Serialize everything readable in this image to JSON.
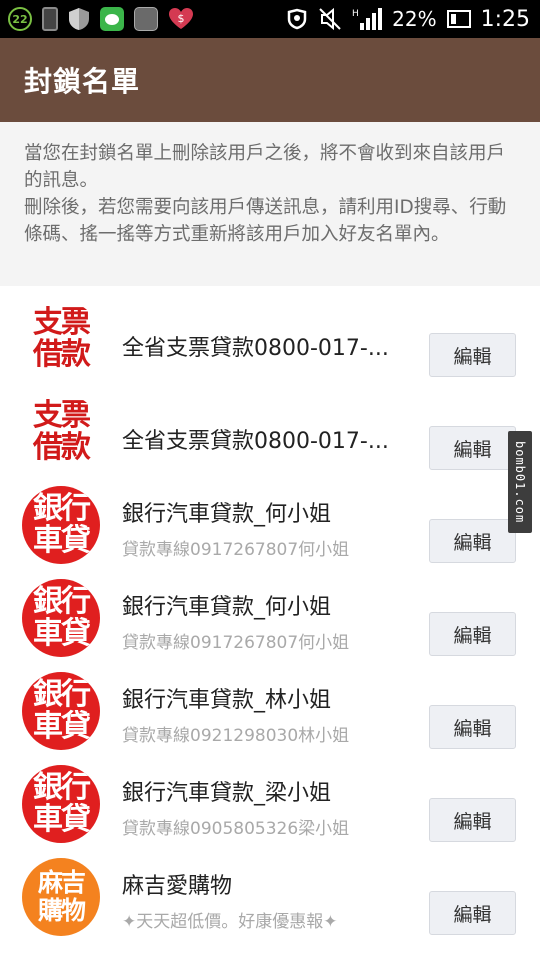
{
  "status_bar": {
    "notification_count": "22",
    "battery_percent": "22%",
    "time": "1:25"
  },
  "header": {
    "title": "封鎖名單"
  },
  "notice": {
    "line1": "當您在封鎖名單上刪除該用戶之後，將不會收到來自該用戶的訊息。",
    "line2": "刪除後，若您需要向該用戶傳送訊息，請利用ID搜尋、行動條碼、搖一搖等方式重新將該用戶加入好友名單內。"
  },
  "edit_label": "編輯",
  "blocked_users": [
    {
      "name": "全省支票貸款0800-017-...",
      "subtitle": "",
      "avatar_text": [
        "支票",
        "借款"
      ],
      "avatar_style": "stamp"
    },
    {
      "name": "全省支票貸款0800-017-...",
      "subtitle": "",
      "avatar_text": [
        "支票",
        "借款"
      ],
      "avatar_style": "stamp"
    },
    {
      "name": "銀行汽車貸款_何小姐",
      "subtitle": "貸款專線0917267807何小姐",
      "avatar_text": [
        "銀行",
        "車貸"
      ],
      "avatar_style": "red"
    },
    {
      "name": "銀行汽車貸款_何小姐",
      "subtitle": "貸款專線0917267807何小姐",
      "avatar_text": [
        "銀行",
        "車貸"
      ],
      "avatar_style": "red"
    },
    {
      "name": "銀行汽車貸款_林小姐",
      "subtitle": "貸款專線0921298030林小姐",
      "avatar_text": [
        "銀行",
        "車貸"
      ],
      "avatar_style": "red"
    },
    {
      "name": "銀行汽車貸款_梁小姐",
      "subtitle": "貸款專線0905805326梁小姐",
      "avatar_text": [
        "銀行",
        "車貸"
      ],
      "avatar_style": "red"
    },
    {
      "name": "麻吉愛購物",
      "subtitle": "✦天天超低價。好康優惠報✦",
      "avatar_text": [
        "麻吉",
        "購物"
      ],
      "avatar_style": "orange"
    }
  ],
  "watermark": "bomb01.com",
  "colors": {
    "header_bg": "#6b4c3d",
    "avatar_red": "#e01f1f",
    "avatar_orange": "#f4821f",
    "notice_bg": "#f4f4f4"
  }
}
